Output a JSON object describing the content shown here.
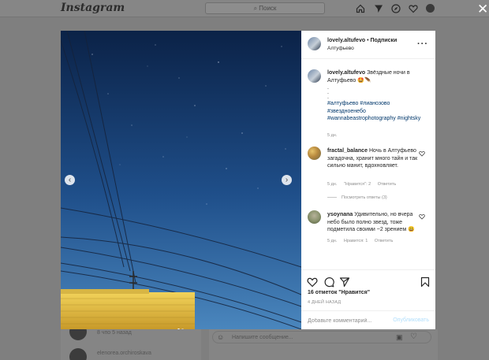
{
  "background": {
    "logo": "Instagram",
    "search_placeholder": "Поиск",
    "feed_time": "8 чпо 5 назад",
    "feed_user": "elenorea.orchiroskava",
    "comment_placeholder": "Напишите сообщение..."
  },
  "post": {
    "username": "lovely.altufevo",
    "follow_separator": "•",
    "follow_label": "Подписки",
    "location": "Алтуфьево",
    "caption_text": "Звёздные ночи в Алтуфьево 🤩🪶",
    "caption_dots": ".\n.\n.",
    "hashtags": "#алтуфьево #лианозово #звездноенебо #wannabeastrophotography #nightsky",
    "caption_time": "5 дн.",
    "comments": [
      {
        "username": "fractal_balance",
        "text": "Ночь в Алтуфьево загадочна, хранит много тайн и так сильно манит, вдохновляет.",
        "time": "5 дн.",
        "likes": "\"Нравится\": 2",
        "reply": "Ответить",
        "view_replies": "Посмотреть ответы (3)"
      },
      {
        "username": "ysoynana",
        "text": "Удивительно, но вчера небо было полно звезд, тоже подметила своими ~2 зрением 😃",
        "time": "5 дн.",
        "likes": "Нравится: 1",
        "reply": "Ответить"
      }
    ],
    "likes_summary": "16 отметок \"Нравится\"",
    "posted_ago": "4 ДНЕЙ НАЗАД",
    "add_comment_placeholder": "Добавьте комментарий...",
    "publish_label": "Опубликовать",
    "slide_count": 2,
    "active_slide": 1
  },
  "colors": {
    "sky_top": "#0b2247",
    "sky_bottom": "#4a86bd",
    "building": "#e1bb3a",
    "hashtag": "#00376b",
    "publish_disabled": "#b2dffc"
  }
}
